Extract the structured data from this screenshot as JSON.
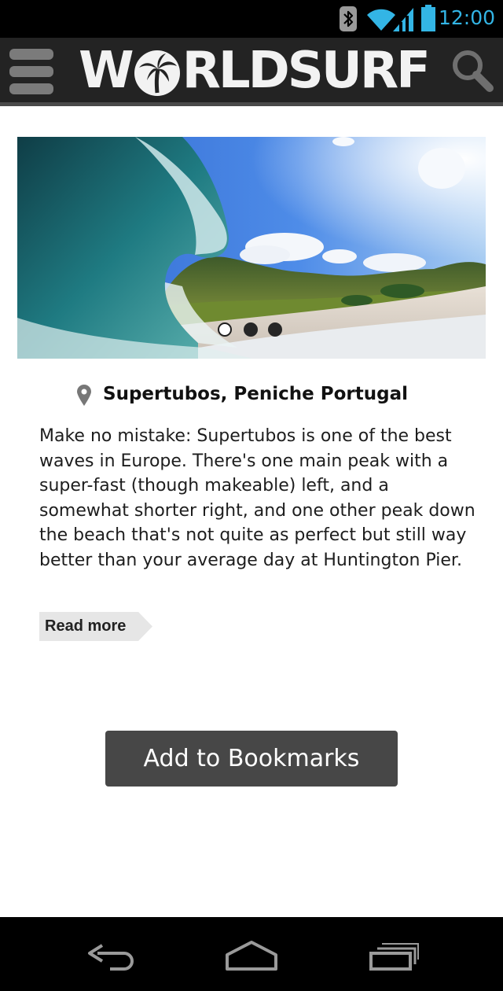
{
  "status_bar": {
    "time": "12:00",
    "icons": [
      "bluetooth-icon",
      "wifi-icon",
      "signal-icon",
      "battery-icon"
    ],
    "accent_color": "#33b5e5"
  },
  "header": {
    "logo_text_left": "W",
    "logo_text_right": "RLDSURF",
    "menu_icon": "hamburger-menu-icon",
    "search_icon": "search-icon",
    "background_color": "#232323"
  },
  "carousel": {
    "slide_count": 3,
    "active_index": 0,
    "image_subject": "wave-barrel-with-green-mountains"
  },
  "spot": {
    "title": "Supertubos, Peniche Portugal",
    "pin_icon": "map-pin-icon",
    "description": "Make no mistake: Supertubos is one of the best waves in Europe. There's one main peak with a super-fast (though makeable) left, and a somewhat shorter right, and one other peak down the beach that's not quite as perfect but still way better than your average day at Huntington Pier.",
    "read_more_label": "Read more"
  },
  "actions": {
    "bookmark_label": "Add to Bookmarks",
    "bookmark_color": "#474747"
  },
  "nav_bar": {
    "buttons": [
      "back-icon",
      "home-icon",
      "recent-apps-icon"
    ]
  }
}
